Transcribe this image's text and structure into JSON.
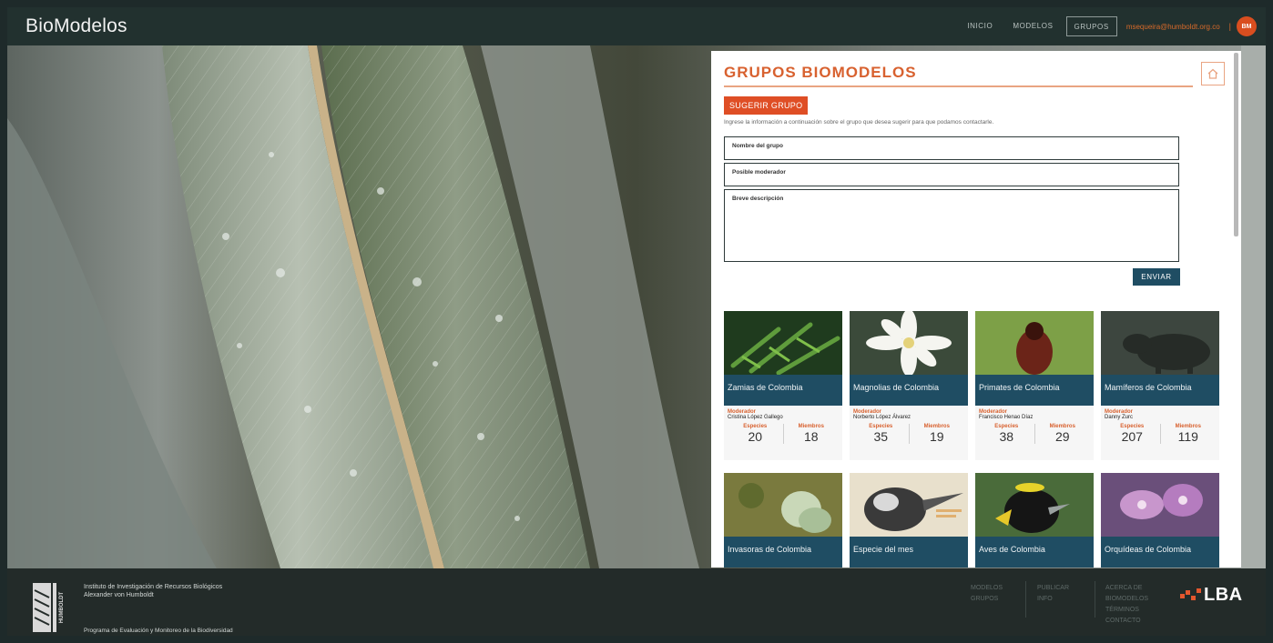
{
  "app": {
    "title": "BioModelos"
  },
  "nav": {
    "items": [
      "INICIO",
      "MODELOS",
      "GRUPOS"
    ],
    "active": "GRUPOS",
    "email": "msequeira@humboldt.org.co",
    "separator": "| ",
    "avatar_text": "BM"
  },
  "panel": {
    "title": "GRUPOS BIOMODELOS",
    "suggest_button": "SUGERIR GRUPO",
    "suggest_description": "Ingrese la información a continuación sobre el grupo que desea sugerir para que podamos contactarle.",
    "fields": {
      "group_name": "Nombre del grupo",
      "moderator": "Posible moderador",
      "description": "Breve descripción"
    },
    "send_button": "ENVIAR"
  },
  "labels": {
    "moderator": "Moderador",
    "species": "Especies",
    "members": "Miembros"
  },
  "groups": [
    {
      "name": "Zamias de Colombia",
      "moderator": "Cristina López Gallego",
      "species": "20",
      "members": "18"
    },
    {
      "name": "Magnolias de Colombia",
      "moderator": "Norberto López Álvarez",
      "species": "35",
      "members": "19"
    },
    {
      "name": "Primates de Colombia",
      "moderator": "Francisco Henao Díaz",
      "species": "38",
      "members": "29"
    },
    {
      "name": "Mamíferos de Colombia",
      "moderator": "Danny Zurc",
      "species": "207",
      "members": "119"
    },
    {
      "name": "Invasoras de Colombia"
    },
    {
      "name": "Especie del mes"
    },
    {
      "name": "Aves de Colombia"
    },
    {
      "name": "Orquídeas de Colombia"
    }
  ],
  "footer": {
    "institute_line1": "Instituto de Investigación de Recursos Biológicos",
    "institute_line2": "Alexander von Humboldt",
    "program": "Programa de Evaluación y Monitoreo de la Biodiversidad",
    "logo_text": "HUMBOLDT",
    "col1": [
      "MODELOS",
      "GRUPOS"
    ],
    "col2": [
      "PUBLICAR",
      "INFO"
    ],
    "col3": [
      "ACERCA DE",
      "BIOMODELOS",
      "TÉRMINOS",
      "CONTACTO"
    ],
    "partner": "LBA"
  },
  "colors": {
    "accent": "#d8612f",
    "navy": "#1f4d63",
    "topbar": "#22312f"
  }
}
